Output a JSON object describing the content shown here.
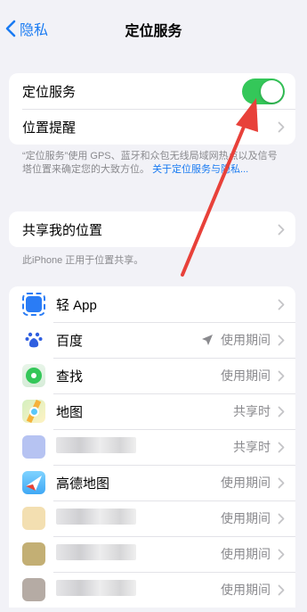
{
  "nav": {
    "back_label": "隐私",
    "title": "定位服务"
  },
  "location_group": {
    "toggle_label": "定位服务",
    "toggle_on": true,
    "alerts_label": "位置提醒"
  },
  "location_note": {
    "text": "“定位服务”使用 GPS、蓝牙和众包无线局域网热点以及信号塔位置来确定您的大致方位。",
    "link": "关于定位服务与隐私..."
  },
  "share_group": {
    "label": "共享我的位置"
  },
  "share_note": "此iPhone 正用于位置共享。",
  "apps": [
    {
      "name": "轻 App",
      "value": "",
      "icon": "app-clip-icon",
      "color": "#2a7cf5"
    },
    {
      "name": "百度",
      "value": "使用期间",
      "icon": "baidu-icon",
      "color": "#2f5fe0",
      "arrow": true
    },
    {
      "name": "查找",
      "value": "使用期间",
      "icon": "find-my-icon",
      "color": "#34c759"
    },
    {
      "name": "地图",
      "value": "共享时",
      "icon": "maps-icon",
      "color": "#5ac8fa"
    },
    {
      "name": "",
      "value": "共享时",
      "icon": "blurred-app-icon",
      "color": "#a9b8f0",
      "blurred": true
    },
    {
      "name": "高德地图",
      "value": "使用期间",
      "icon": "amap-icon",
      "color": "#1e78ff"
    },
    {
      "name": "",
      "value": "使用期间",
      "icon": "blurred-app-icon",
      "color": "#f1d9a3",
      "blurred": true
    },
    {
      "name": "",
      "value": "使用期间",
      "icon": "blurred-app-icon",
      "color": "#b9a15c",
      "blurred": true
    },
    {
      "name": "",
      "value": "使用期间",
      "icon": "blurred-app-icon",
      "color": "#a89c94",
      "blurred": true
    }
  ],
  "colors": {
    "accent": "#1a7bf2",
    "toggle_on": "#34c759",
    "annotation": "#e8413a"
  }
}
